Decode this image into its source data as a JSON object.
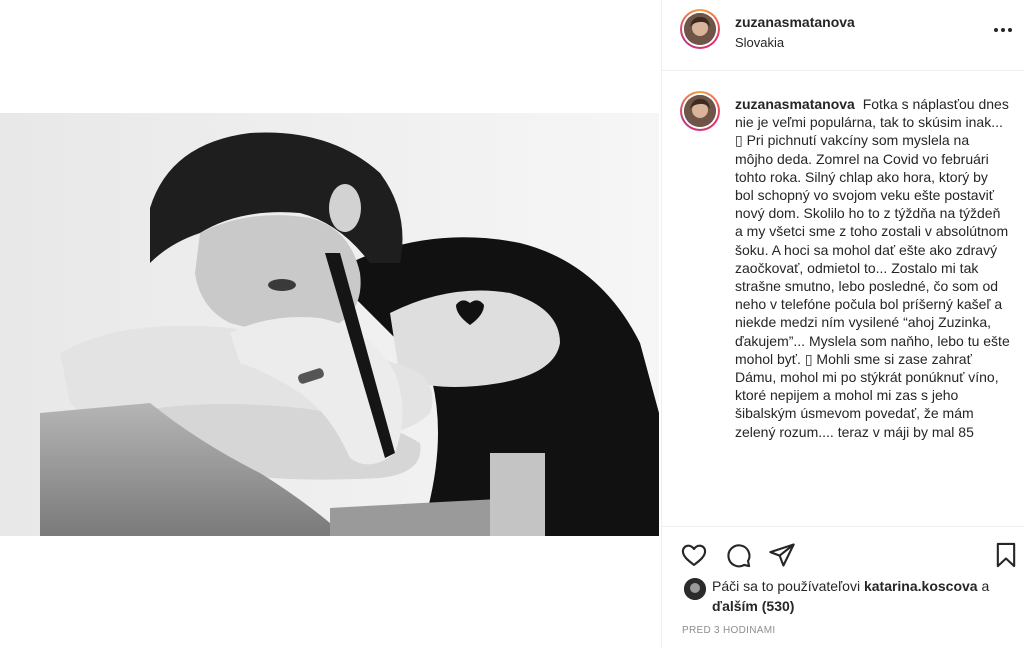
{
  "post": {
    "author": "zuzanasmatanova",
    "location": "Slovakia",
    "more_icon": "more-horizontal-icon",
    "photo_alt": "Čiernobiela fotografia ženy s opretou hlavou o ruky na stoličke",
    "caption": {
      "author": "zuzanasmatanova",
      "text": "Fotka s náplasťou dnes nie je veľmi populárna, tak to skúsim inak... ▯ Pri pichnutí vakcíny som myslela na môjho deda. Zomrel na Covid vo februári tohto roka. Silný chlap ako hora, ktorý by bol schopný vo svojom veku ešte postaviť nový dom. Skolilo ho to z týždňa na týždeň a my všetci sme z toho zostali v absolútnom šoku. A hoci sa mohol dať ešte ako zdravý zaočkovať, odmietol to... Zostalo mi tak strašne smutno, lebo posledné, čo som od neho v telefóne počula bol príšerný kašeľ a niekde medzi ním vysilené “ahoj Zuzinka, ďakujem”... Myslela som naňho, lebo tu ešte mohol byť. ▯ Mohli sme si zase zahrať Dámu, mohol mi po stýkrát ponúknuť víno, ktoré nepijem a mohol mi zas s jeho šibalským úsmevom povedať, že mám zelený rozum.... teraz v máji by mal 85"
    },
    "actions": {
      "like_icon": "heart-icon",
      "comment_icon": "comment-icon",
      "share_icon": "send-icon",
      "save_icon": "bookmark-icon"
    },
    "likes": {
      "prefix": "Páči sa to používateľovi ",
      "user": "katarina.koscova",
      "middle": " a ",
      "others_label": "ďalším (530)"
    },
    "timestamp": "PRED 3 HODINAMI"
  },
  "colors": {
    "text": "#262626",
    "secondary": "#8e8e8e",
    "border": "#efefef"
  }
}
